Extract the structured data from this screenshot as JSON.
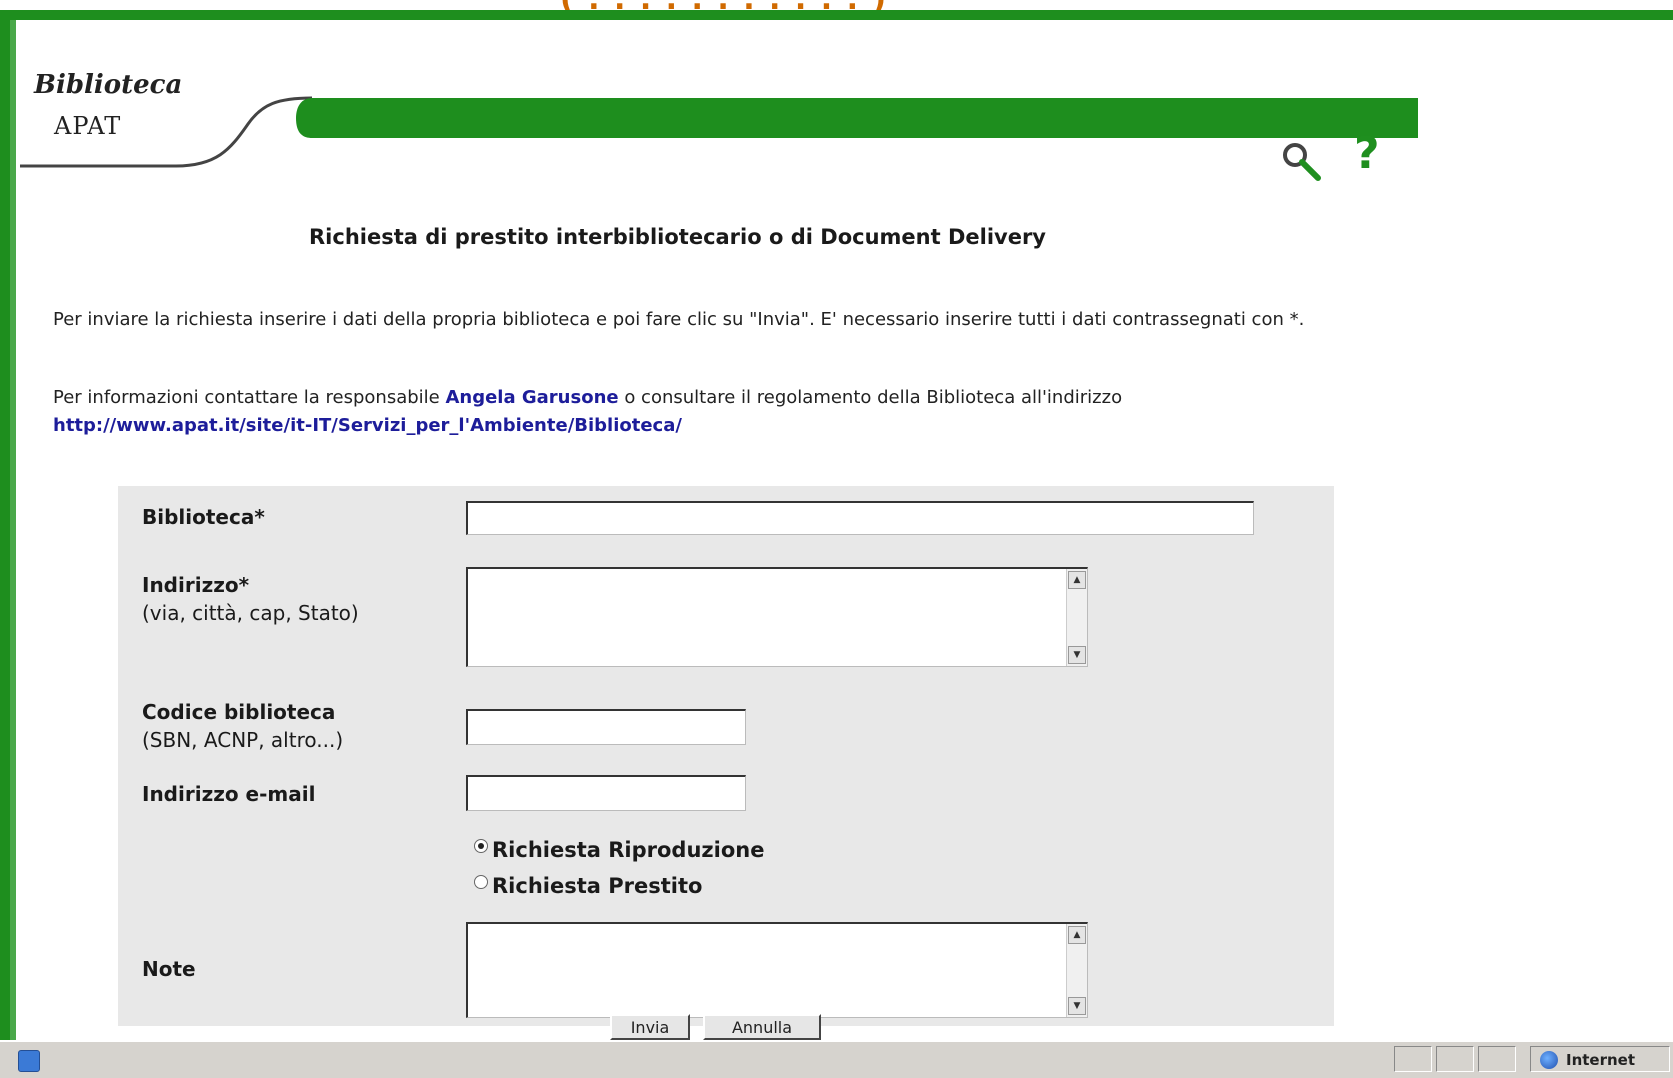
{
  "header": {
    "logo_line1": "Biblioteca",
    "logo_line2": "APAT",
    "brand_green": "#1e8e1e",
    "search_icon": "search-icon",
    "help_icon": "?"
  },
  "page": {
    "title": "Richiesta di prestito interbibliotecario o di Document Delivery",
    "para1": "Per inviare la richiesta inserire i dati della propria biblioteca e poi fare clic su \"Invia\". E' necessario inserire tutti i dati contrassegnati con *.",
    "para2_before": "Per informazioni contattare la responsabile ",
    "contact_name": "Angela Garusone",
    "para2_middle": " o consultare il regolamento della Biblioteca all'indirizzo ",
    "url": "http://www.apat.it/site/it-IT/Servizi_per_l'Ambiente/Biblioteca/"
  },
  "form": {
    "biblioteca_label": "Biblioteca*",
    "biblioteca_value": "",
    "indirizzo_label": "Indirizzo*",
    "indirizzo_hint": "(via, città, cap, Stato)",
    "indirizzo_value": "",
    "codice_label": "Codice biblioteca",
    "codice_hint": "(SBN, ACNP, altro...)",
    "codice_value": "",
    "email_label": "Indirizzo e-mail",
    "email_value": "",
    "radio_riproduzione": "Richiesta Riproduzione",
    "radio_prestito": "Richiesta Prestito",
    "radio_selected": "Richiesta Riproduzione",
    "note_label": "Note",
    "note_value": "",
    "submit_label": "Invia",
    "reset_label": "Annulla"
  },
  "statusbar": {
    "zone_label": "Internet",
    "zone_icon": "globe-icon",
    "page_icon": "ie-page-icon"
  }
}
